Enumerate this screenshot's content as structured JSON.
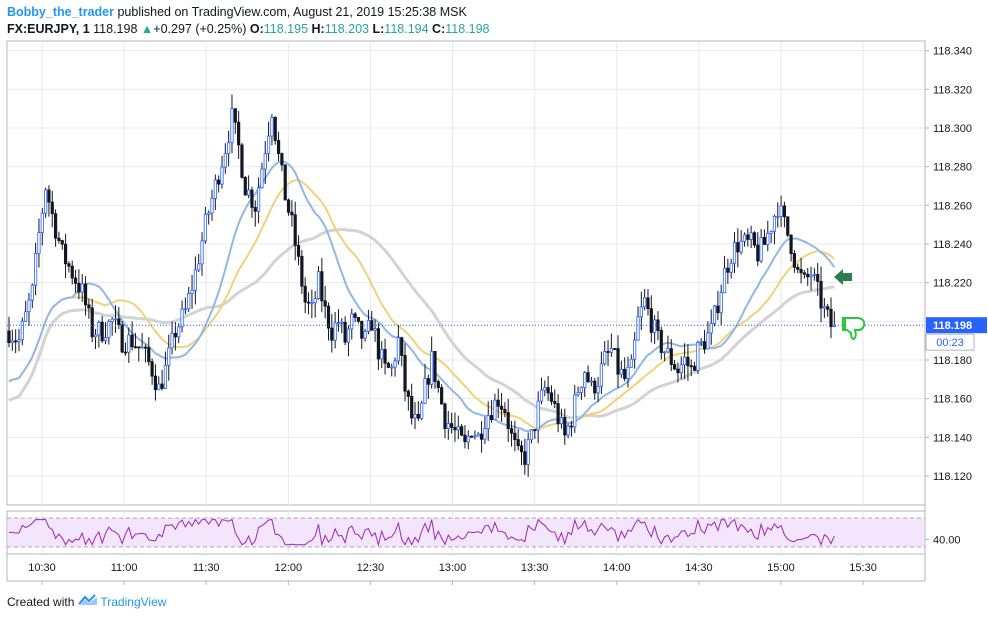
{
  "header": {
    "author": "Bobby_the_trader",
    "published_text": "published on TradingView.com, August 21, 2019 15:25:38 MSK",
    "symbol": "FX:EURJPY, 1",
    "last_price": "118.198",
    "change_arrow": "▲",
    "change": "+0.297 (+0.25%)",
    "open_label": "O:",
    "open": "118.195",
    "high_label": "H:",
    "high": "118.203",
    "low_label": "L:",
    "low": "118.194",
    "close_label": "C:",
    "close": "118.198"
  },
  "footer": {
    "created_with": "Created with",
    "brand": "TradingView"
  },
  "colors": {
    "bull": "#2962ff",
    "bear": "#131722",
    "ma_blue": "#90b8e6",
    "ma_yellow": "#f0d27a",
    "ma_grey": "#d3d3d3",
    "rsi": "#9c27b0",
    "rsi_band": "#f3e5fb",
    "price_label_bg": "#2962ff",
    "arrow_green": "#2e7d4f",
    "thumb_green": "#27c93f"
  },
  "chart_data": {
    "type": "candlestick",
    "symbol": "FX:EURJPY",
    "interval": "1",
    "ylim": [
      118.105,
      118.345
    ],
    "y_ticks": [
      "118.340",
      "118.320",
      "118.300",
      "118.280",
      "118.260",
      "118.240",
      "118.220",
      "118.200",
      "118.180",
      "118.160",
      "118.140",
      "118.120"
    ],
    "x_ticks": [
      "10:30",
      "11:00",
      "11:30",
      "12:00",
      "12:30",
      "13:00",
      "13:30",
      "14:00",
      "14:30",
      "15:00",
      "15:30"
    ],
    "current_price_label": "118.198",
    "countdown_label": "00:23",
    "close_profile": [
      [
        0,
        118.195
      ],
      [
        3,
        118.19
      ],
      [
        7,
        118.215
      ],
      [
        9,
        118.245
      ],
      [
        11,
        118.27
      ],
      [
        13,
        118.255
      ],
      [
        16,
        118.235
      ],
      [
        19,
        118.225
      ],
      [
        22,
        118.215
      ],
      [
        25,
        118.195
      ],
      [
        28,
        118.195
      ],
      [
        31,
        118.2
      ],
      [
        34,
        118.19
      ],
      [
        37,
        118.19
      ],
      [
        40,
        118.185
      ],
      [
        43,
        118.175
      ],
      [
        45,
        118.165
      ],
      [
        47,
        118.175
      ],
      [
        50,
        118.195
      ],
      [
        53,
        118.205
      ],
      [
        56,
        118.225
      ],
      [
        59,
        118.25
      ],
      [
        62,
        118.27
      ],
      [
        65,
        118.29
      ],
      [
        67,
        118.305
      ],
      [
        69,
        118.29
      ],
      [
        71,
        118.27
      ],
      [
        74,
        118.26
      ],
      [
        77,
        118.29
      ],
      [
        79,
        118.31
      ],
      [
        81,
        118.285
      ],
      [
        83,
        118.265
      ],
      [
        85,
        118.25
      ],
      [
        87,
        118.23
      ],
      [
        89,
        118.21
      ],
      [
        91,
        118.205
      ],
      [
        93,
        118.22
      ],
      [
        95,
        118.205
      ],
      [
        97,
        118.195
      ],
      [
        99,
        118.2
      ],
      [
        101,
        118.19
      ],
      [
        103,
        118.2
      ],
      [
        105,
        118.195
      ],
      [
        107,
        118.19
      ],
      [
        109,
        118.2
      ],
      [
        111,
        118.185
      ],
      [
        113,
        118.175
      ],
      [
        115,
        118.175
      ],
      [
        117,
        118.19
      ],
      [
        119,
        118.165
      ],
      [
        121,
        118.15
      ],
      [
        123,
        118.145
      ],
      [
        125,
        118.165
      ],
      [
        127,
        118.18
      ],
      [
        129,
        118.165
      ],
      [
        131,
        118.15
      ],
      [
        133,
        118.145
      ],
      [
        135,
        118.14
      ],
      [
        137,
        118.135
      ],
      [
        139,
        118.145
      ],
      [
        141,
        118.14
      ],
      [
        143,
        118.15
      ],
      [
        145,
        118.155
      ],
      [
        147,
        118.16
      ],
      [
        149,
        118.155
      ],
      [
        151,
        118.14
      ],
      [
        153,
        118.13
      ],
      [
        155,
        118.13
      ],
      [
        157,
        118.14
      ],
      [
        159,
        118.155
      ],
      [
        161,
        118.165
      ],
      [
        163,
        118.16
      ],
      [
        165,
        118.15
      ],
      [
        167,
        118.14
      ],
      [
        169,
        118.15
      ],
      [
        171,
        118.165
      ],
      [
        173,
        118.175
      ],
      [
        175,
        118.165
      ],
      [
        177,
        118.17
      ],
      [
        179,
        118.18
      ],
      [
        181,
        118.185
      ],
      [
        183,
        118.175
      ],
      [
        185,
        118.17
      ],
      [
        187,
        118.175
      ],
      [
        189,
        118.2
      ],
      [
        191,
        118.21
      ],
      [
        193,
        118.2
      ],
      [
        195,
        118.19
      ],
      [
        197,
        118.185
      ],
      [
        199,
        118.18
      ],
      [
        201,
        118.175
      ],
      [
        203,
        118.18
      ],
      [
        205,
        118.175
      ],
      [
        207,
        118.185
      ],
      [
        209,
        118.19
      ],
      [
        211,
        118.195
      ],
      [
        213,
        118.21
      ],
      [
        215,
        118.225
      ],
      [
        217,
        118.235
      ],
      [
        219,
        118.24
      ],
      [
        221,
        118.24
      ],
      [
        223,
        118.24
      ],
      [
        225,
        118.235
      ],
      [
        227,
        118.24
      ],
      [
        229,
        118.25
      ],
      [
        231,
        118.26
      ],
      [
        233,
        118.25
      ],
      [
        235,
        118.24
      ],
      [
        237,
        118.225
      ],
      [
        239,
        118.22
      ],
      [
        241,
        118.225
      ],
      [
        243,
        118.215
      ],
      [
        245,
        118.205
      ],
      [
        247,
        118.198
      ]
    ],
    "series": [
      {
        "name": "",
        "role": "ma_fast",
        "color": "#90b8e6"
      },
      {
        "name": "",
        "role": "ma_mid",
        "color": "#f0d27a"
      },
      {
        "name": "",
        "role": "ma_slow",
        "color": "#d3d3d3"
      }
    ],
    "rsi": {
      "ylim": [
        20,
        80
      ],
      "tick_label": "40.00",
      "upper_band": 70,
      "lower_band": 30
    }
  }
}
